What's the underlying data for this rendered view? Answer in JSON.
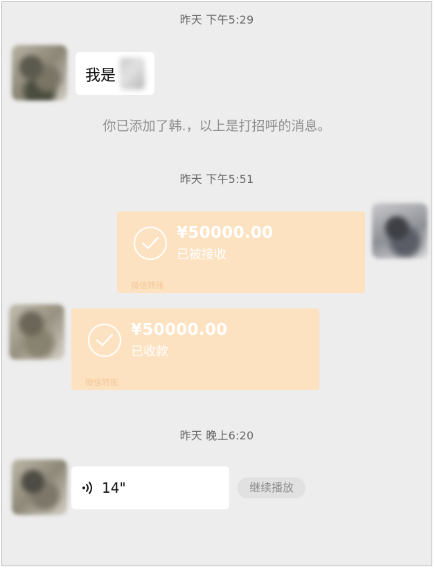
{
  "chat": {
    "timestamps": {
      "t1": "昨天 下午5:29",
      "t2": "昨天 下午5:51",
      "t3": "昨天 晚上6:20"
    },
    "greeting_text": "我是",
    "system_message": "你已添加了韩.，以上是打招呼的消息。",
    "transfer_sent": {
      "amount": "¥50000.00",
      "status": "已被接收",
      "source": "微信转账"
    },
    "transfer_received": {
      "amount": "¥50000.00",
      "status": "已收款",
      "source": "微信转账"
    },
    "voice": {
      "duration": "14\"",
      "icon": "voice-wave-icon"
    },
    "continue_play_label": "继续播放",
    "colors": {
      "background": "#ededed",
      "transfer_bg": "#fde2c1",
      "bubble_bg": "#ffffff"
    }
  }
}
